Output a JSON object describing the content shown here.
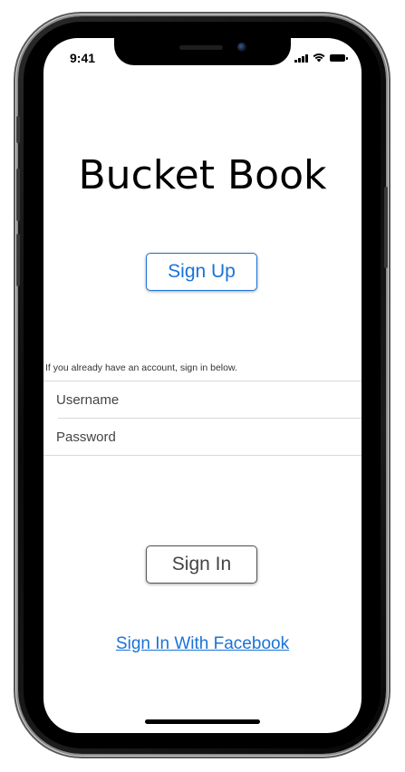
{
  "status_bar": {
    "time": "9:41",
    "icons": [
      "cellular-signal-icon",
      "wifi-icon",
      "battery-icon"
    ]
  },
  "app": {
    "title": "Bucket Book"
  },
  "signup": {
    "label": "Sign Up"
  },
  "login": {
    "hint": "If you already have an account, sign in below.",
    "username_placeholder": "Username",
    "password_placeholder": "Password",
    "username_value": "",
    "password_value": ""
  },
  "signin": {
    "label": "Sign In"
  },
  "facebook": {
    "label": "Sign In With Facebook"
  },
  "colors": {
    "accent": "#1a73d9",
    "text": "#000000",
    "button_border": "#555555",
    "separator": "#d8d8d8"
  }
}
